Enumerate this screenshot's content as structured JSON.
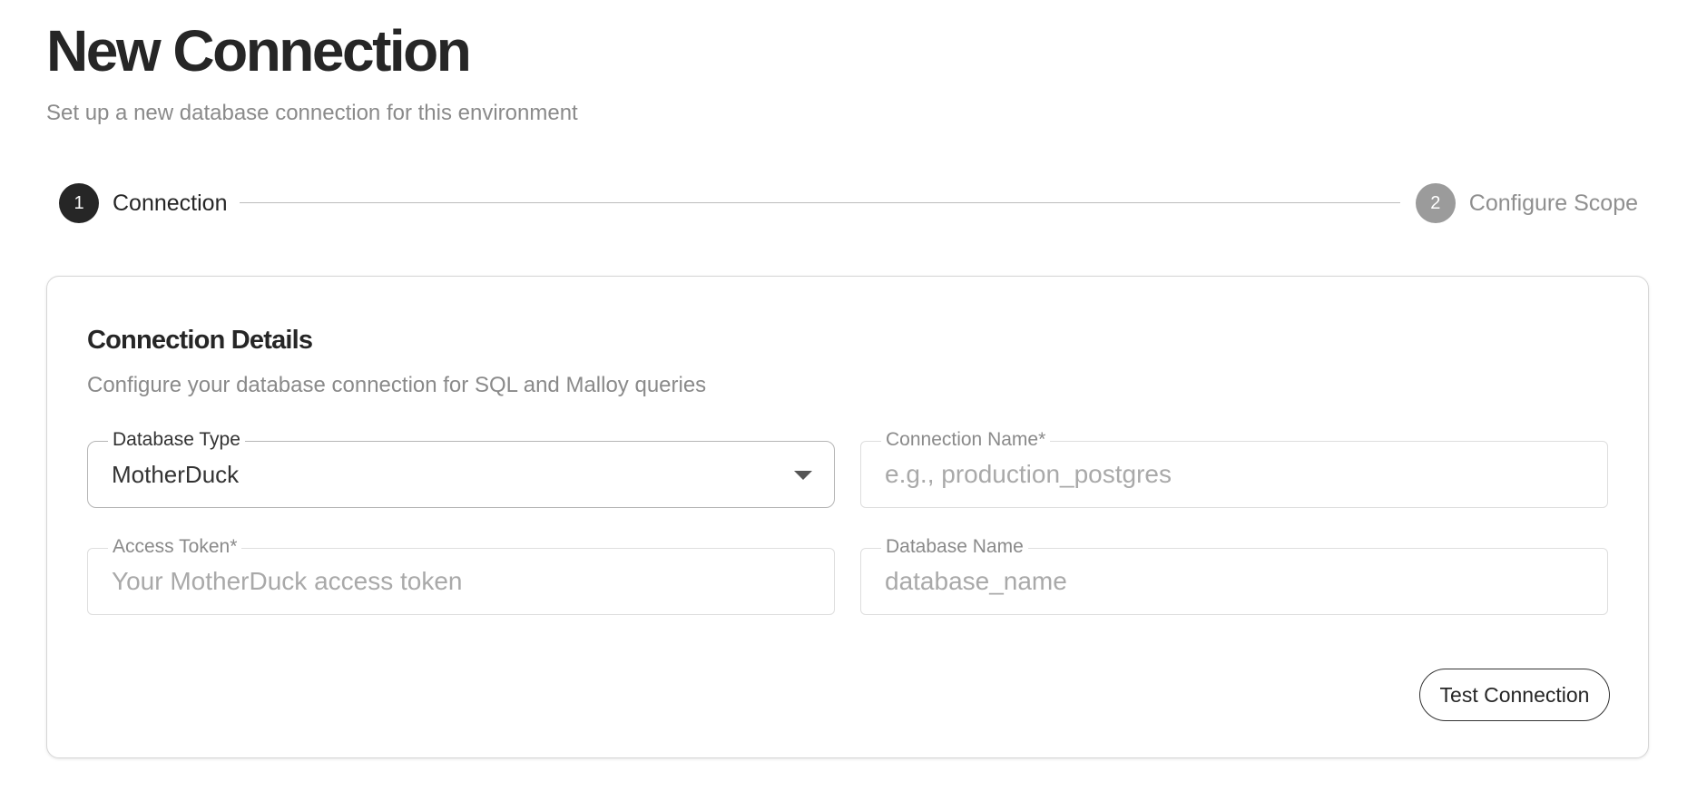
{
  "header": {
    "title": "New Connection",
    "subtitle": "Set up a new database connection for this environment"
  },
  "stepper": {
    "steps": [
      {
        "number": "1",
        "label": "Connection",
        "state": "active"
      },
      {
        "number": "2",
        "label": "Configure Scope",
        "state": "inactive"
      }
    ]
  },
  "card": {
    "title": "Connection Details",
    "subtitle": "Configure your database connection for SQL and Malloy queries",
    "fields": {
      "database_type": {
        "label": "Database Type",
        "value": "MotherDuck"
      },
      "connection_name": {
        "label": "Connection Name",
        "required_mark": "*",
        "value": "",
        "placeholder": "e.g., production_postgres"
      },
      "access_token": {
        "label": "Access Token",
        "required_mark": "*",
        "value": "",
        "placeholder": "Your MotherDuck access token"
      },
      "database_name": {
        "label": "Database Name",
        "value": "",
        "placeholder": "database_name"
      }
    },
    "test_button_label": "Test Connection"
  },
  "icons": {
    "dropdown": "chevron-down-icon"
  },
  "colors": {
    "active_step": "#262626",
    "inactive_step": "#9b9b9b",
    "placeholder": "#a9a9a9",
    "muted_text": "#8a8a8a"
  }
}
